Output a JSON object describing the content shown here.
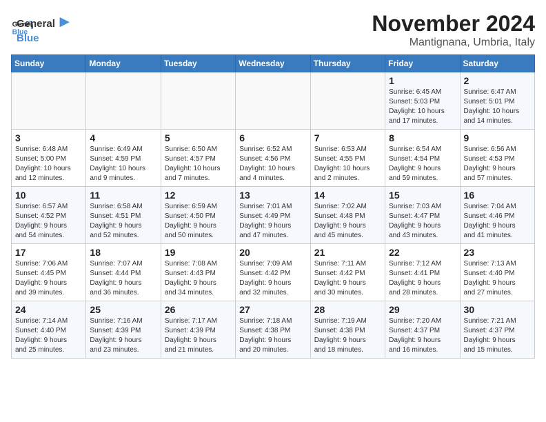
{
  "logo": {
    "line1": "General",
    "line2": "Blue"
  },
  "title": "November 2024",
  "location": "Mantignana, Umbria, Italy",
  "days_of_week": [
    "Sunday",
    "Monday",
    "Tuesday",
    "Wednesday",
    "Thursday",
    "Friday",
    "Saturday"
  ],
  "weeks": [
    [
      {
        "day": "",
        "info": ""
      },
      {
        "day": "",
        "info": ""
      },
      {
        "day": "",
        "info": ""
      },
      {
        "day": "",
        "info": ""
      },
      {
        "day": "",
        "info": ""
      },
      {
        "day": "1",
        "info": "Sunrise: 6:45 AM\nSunset: 5:03 PM\nDaylight: 10 hours\nand 17 minutes."
      },
      {
        "day": "2",
        "info": "Sunrise: 6:47 AM\nSunset: 5:01 PM\nDaylight: 10 hours\nand 14 minutes."
      }
    ],
    [
      {
        "day": "3",
        "info": "Sunrise: 6:48 AM\nSunset: 5:00 PM\nDaylight: 10 hours\nand 12 minutes."
      },
      {
        "day": "4",
        "info": "Sunrise: 6:49 AM\nSunset: 4:59 PM\nDaylight: 10 hours\nand 9 minutes."
      },
      {
        "day": "5",
        "info": "Sunrise: 6:50 AM\nSunset: 4:57 PM\nDaylight: 10 hours\nand 7 minutes."
      },
      {
        "day": "6",
        "info": "Sunrise: 6:52 AM\nSunset: 4:56 PM\nDaylight: 10 hours\nand 4 minutes."
      },
      {
        "day": "7",
        "info": "Sunrise: 6:53 AM\nSunset: 4:55 PM\nDaylight: 10 hours\nand 2 minutes."
      },
      {
        "day": "8",
        "info": "Sunrise: 6:54 AM\nSunset: 4:54 PM\nDaylight: 9 hours\nand 59 minutes."
      },
      {
        "day": "9",
        "info": "Sunrise: 6:56 AM\nSunset: 4:53 PM\nDaylight: 9 hours\nand 57 minutes."
      }
    ],
    [
      {
        "day": "10",
        "info": "Sunrise: 6:57 AM\nSunset: 4:52 PM\nDaylight: 9 hours\nand 54 minutes."
      },
      {
        "day": "11",
        "info": "Sunrise: 6:58 AM\nSunset: 4:51 PM\nDaylight: 9 hours\nand 52 minutes."
      },
      {
        "day": "12",
        "info": "Sunrise: 6:59 AM\nSunset: 4:50 PM\nDaylight: 9 hours\nand 50 minutes."
      },
      {
        "day": "13",
        "info": "Sunrise: 7:01 AM\nSunset: 4:49 PM\nDaylight: 9 hours\nand 47 minutes."
      },
      {
        "day": "14",
        "info": "Sunrise: 7:02 AM\nSunset: 4:48 PM\nDaylight: 9 hours\nand 45 minutes."
      },
      {
        "day": "15",
        "info": "Sunrise: 7:03 AM\nSunset: 4:47 PM\nDaylight: 9 hours\nand 43 minutes."
      },
      {
        "day": "16",
        "info": "Sunrise: 7:04 AM\nSunset: 4:46 PM\nDaylight: 9 hours\nand 41 minutes."
      }
    ],
    [
      {
        "day": "17",
        "info": "Sunrise: 7:06 AM\nSunset: 4:45 PM\nDaylight: 9 hours\nand 39 minutes."
      },
      {
        "day": "18",
        "info": "Sunrise: 7:07 AM\nSunset: 4:44 PM\nDaylight: 9 hours\nand 36 minutes."
      },
      {
        "day": "19",
        "info": "Sunrise: 7:08 AM\nSunset: 4:43 PM\nDaylight: 9 hours\nand 34 minutes."
      },
      {
        "day": "20",
        "info": "Sunrise: 7:09 AM\nSunset: 4:42 PM\nDaylight: 9 hours\nand 32 minutes."
      },
      {
        "day": "21",
        "info": "Sunrise: 7:11 AM\nSunset: 4:42 PM\nDaylight: 9 hours\nand 30 minutes."
      },
      {
        "day": "22",
        "info": "Sunrise: 7:12 AM\nSunset: 4:41 PM\nDaylight: 9 hours\nand 28 minutes."
      },
      {
        "day": "23",
        "info": "Sunrise: 7:13 AM\nSunset: 4:40 PM\nDaylight: 9 hours\nand 27 minutes."
      }
    ],
    [
      {
        "day": "24",
        "info": "Sunrise: 7:14 AM\nSunset: 4:40 PM\nDaylight: 9 hours\nand 25 minutes."
      },
      {
        "day": "25",
        "info": "Sunrise: 7:16 AM\nSunset: 4:39 PM\nDaylight: 9 hours\nand 23 minutes."
      },
      {
        "day": "26",
        "info": "Sunrise: 7:17 AM\nSunset: 4:39 PM\nDaylight: 9 hours\nand 21 minutes."
      },
      {
        "day": "27",
        "info": "Sunrise: 7:18 AM\nSunset: 4:38 PM\nDaylight: 9 hours\nand 20 minutes."
      },
      {
        "day": "28",
        "info": "Sunrise: 7:19 AM\nSunset: 4:38 PM\nDaylight: 9 hours\nand 18 minutes."
      },
      {
        "day": "29",
        "info": "Sunrise: 7:20 AM\nSunset: 4:37 PM\nDaylight: 9 hours\nand 16 minutes."
      },
      {
        "day": "30",
        "info": "Sunrise: 7:21 AM\nSunset: 4:37 PM\nDaylight: 9 hours\nand 15 minutes."
      }
    ]
  ]
}
